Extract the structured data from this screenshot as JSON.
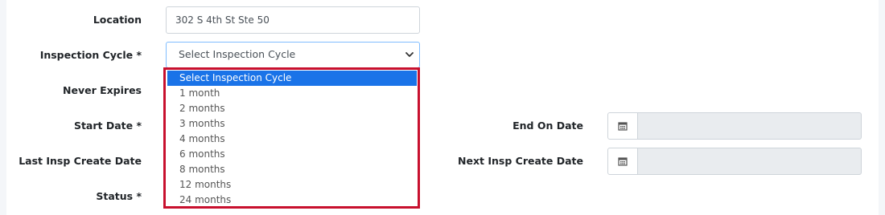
{
  "form": {
    "location_label": "Location",
    "location_value": "302 S 4th St Ste 50",
    "inspection_cycle_label": "Inspection Cycle *",
    "inspection_cycle_selected": "Select Inspection Cycle",
    "never_expires_label": "Never Expires",
    "start_date_label": "Start Date *",
    "last_insp_label": "Last Insp Create Date",
    "status_label": "Status *",
    "end_on_label": "End On Date",
    "end_on_value": "",
    "next_insp_label": "Next Insp Create Date",
    "next_insp_value": ""
  },
  "dropdown": {
    "options": [
      "Select Inspection Cycle",
      "1 month",
      "2 months",
      "3 months",
      "4 months",
      "6 months",
      "8 months",
      "12 months",
      "24 months"
    ],
    "highlighted_index": 0
  },
  "icons": {
    "select_arrow": "chevron-down-icon",
    "calendar": "calendar-icon"
  },
  "colors": {
    "highlight": "#1a73e8",
    "annotation_border": "#c8102e",
    "disabled_field": "#e9ecef"
  }
}
